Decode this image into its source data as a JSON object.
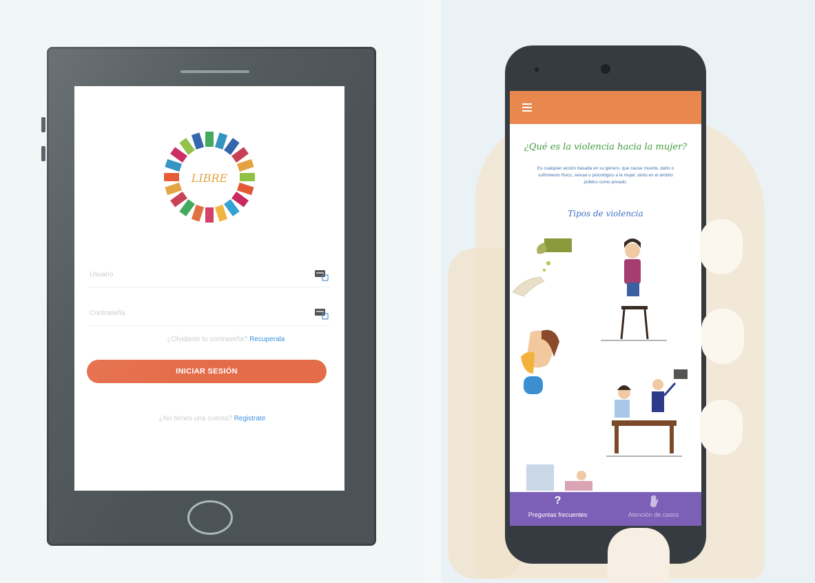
{
  "login_screen": {
    "username_placeholder": "Usuario",
    "password_placeholder": "Contraseña",
    "forgot_prompt": "¿Olvidaste tu contraseña?",
    "recover_link": "Recuperala",
    "login_button": "INICIAR SESIÓN",
    "register_prompt": "¿No tienes una cuenta?",
    "register_link": "Registrate",
    "logo_text": "LIBRE"
  },
  "info_screen": {
    "header_color": "#e8884e",
    "question_title": "¿Qué es la violencia hacia la mujer?",
    "description": "Es cualquier acción basada en su género, que cause muerte, daño o sufrimiento físico, sexual o psicológico a la mujer, tanto en el ámbito público como privado.",
    "types_title": "Tipos de violencia",
    "bottom_nav": [
      {
        "label": "Preguntas frecuentes",
        "icon": "question-icon"
      },
      {
        "label": "Atención de casos",
        "icon": "hand-icon"
      }
    ],
    "nav_color": "#7c5fb7"
  },
  "colors": {
    "primary_button": "#e46c48",
    "link": "#3d8fe0"
  }
}
